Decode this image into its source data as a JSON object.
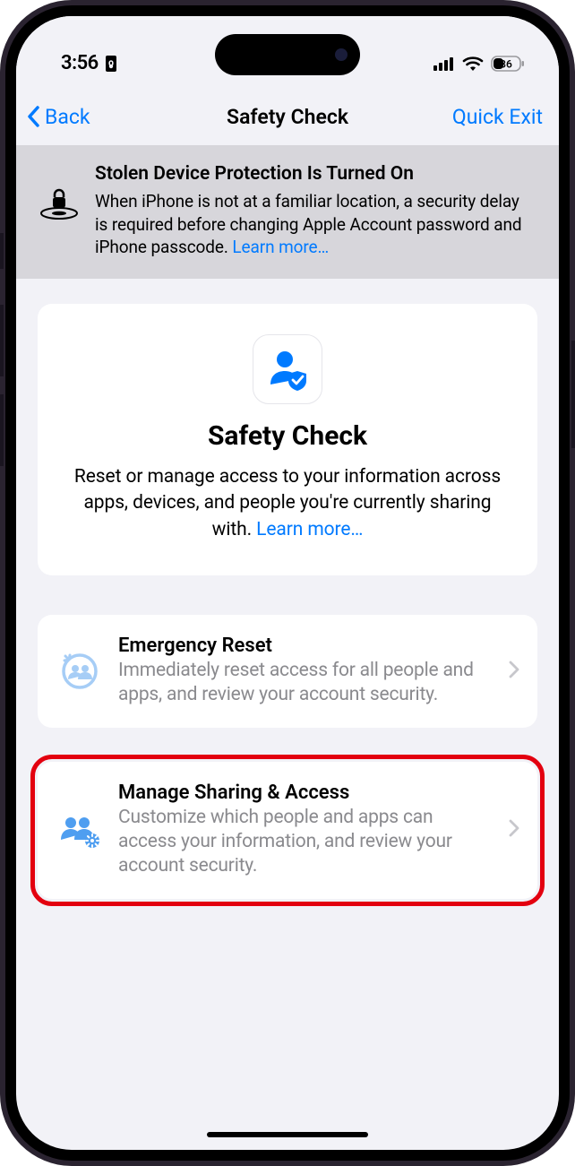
{
  "status": {
    "time": "3:56",
    "battery": "36"
  },
  "nav": {
    "back": "Back",
    "title": "Safety Check",
    "quick_exit": "Quick Exit"
  },
  "banner": {
    "title": "Stolen Device Protection Is Turned On",
    "desc": "When iPhone is not at a familiar location, a security delay is required before changing Apple Account password and iPhone passcode. ",
    "learn_more": "Learn more…"
  },
  "hero": {
    "title": "Safety Check",
    "desc": "Reset or manage access to your information across apps, devices, and people you're currently sharing with. ",
    "learn_more": "Learn more…"
  },
  "options": {
    "emergency": {
      "title": "Emergency Reset",
      "desc": "Immediately reset access for all people and apps, and review your account security."
    },
    "manage": {
      "title": "Manage Sharing & Access",
      "desc": "Customize which people and apps can access your information, and review your account security."
    }
  }
}
